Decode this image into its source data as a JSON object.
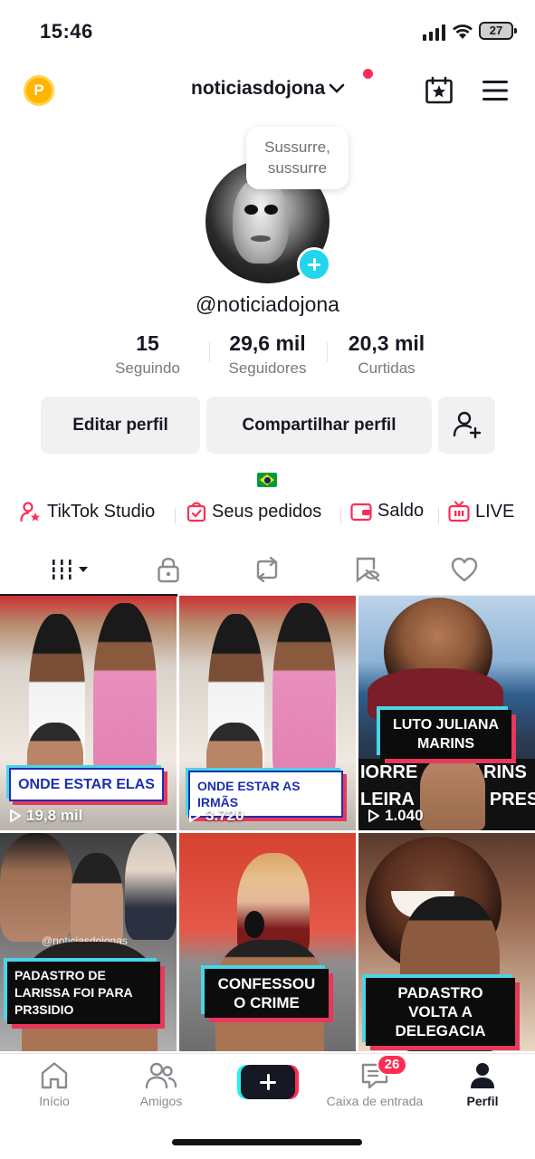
{
  "status_bar": {
    "time": "15:46",
    "battery": "27"
  },
  "header": {
    "username": "noticiasdojona"
  },
  "profile": {
    "note": "Sussurre, sussurre",
    "handle": "@noticiadojona",
    "stats": [
      {
        "value": "15",
        "label": "Seguindo"
      },
      {
        "value": "29,6 mil",
        "label": "Seguidores"
      },
      {
        "value": "20,3 mil",
        "label": "Curtidas"
      }
    ]
  },
  "actions": {
    "edit": "Editar perfil",
    "share": "Compartilhar perfil"
  },
  "links": [
    {
      "label": "TikTok Studio"
    },
    {
      "label": "Seus pedidos"
    },
    {
      "label": "Saldo"
    },
    {
      "label": "LIVE"
    }
  ],
  "videos": [
    {
      "title": "ONDE ESTAR ELAS",
      "views": "19,8 mil",
      "style": "white"
    },
    {
      "title": "ONDE ESTAR AS IRMÃS",
      "views": "3.720",
      "style": "white"
    },
    {
      "title": "LUTO JULIANA MARINS",
      "views": "1.040",
      "style": "black"
    },
    {
      "title": "PADASTRO DE LARISSA FOI PARA PR3SIDIO",
      "watermark": "@noticiasdojonas",
      "style": "black"
    },
    {
      "title": "CONFESSOU O CRIME",
      "style": "black"
    },
    {
      "title": "PADASTRO VOLTA A DELEGACIA",
      "style": "black"
    }
  ],
  "tile3_bg_text": {
    "left": "IORRE",
    "right": "MARINS",
    "line2_left": "LEIRA",
    "line2_right": "AVA PRES"
  },
  "nav": {
    "home": "Início",
    "friends": "Amigos",
    "inbox": "Caixa de entrada",
    "inbox_badge": "26",
    "profile": "Perfil"
  },
  "colors": {
    "accent_red": "#fe2c55",
    "accent_cyan": "#20d5ec",
    "text": "#161823"
  }
}
